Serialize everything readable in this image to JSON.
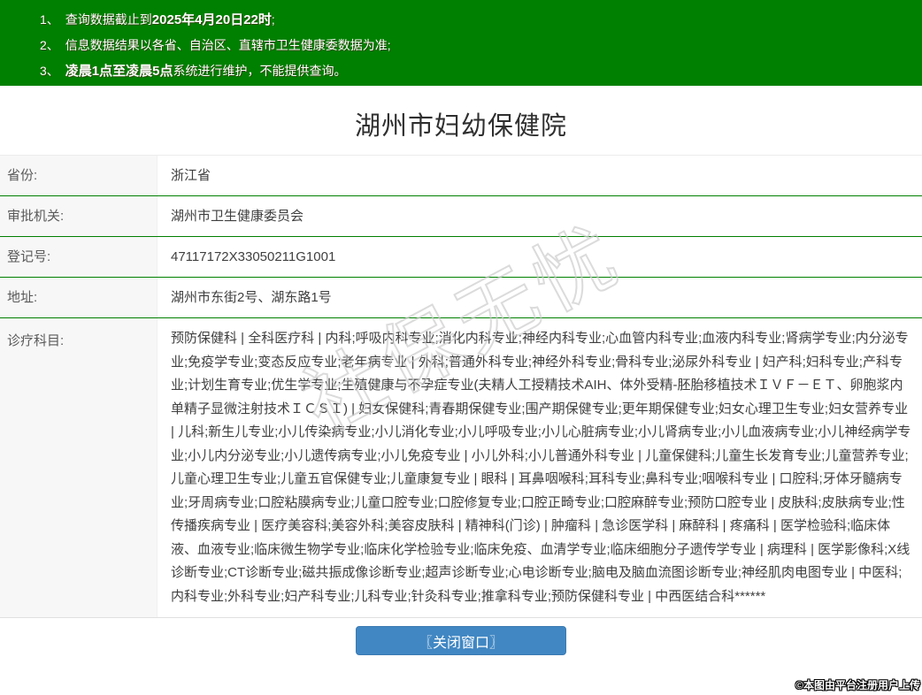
{
  "header": {
    "bg_color": "#008000",
    "text_color": "#ffffff",
    "notices": [
      {
        "num": "1、",
        "pre": "查询数据截止到",
        "bold": "2025年4月20日22时",
        "post": ";"
      },
      {
        "num": "2、",
        "pre": "信息数据结果以各省、自治区、直辖市卫生健康委数据为准;",
        "bold": "",
        "post": ""
      },
      {
        "num": "3、",
        "pre": "",
        "bold": "凌晨1点至凌晨5点",
        "post": "系统进行维护，不能提供查询。"
      }
    ]
  },
  "title": "湖州市妇幼保健院",
  "table": {
    "border_color": "#008000",
    "label_bg_color": "#f7f7f7",
    "rows": [
      {
        "label": "省份:",
        "value": "浙江省"
      },
      {
        "label": "审批机关:",
        "value": "湖州市卫生健康委员会"
      },
      {
        "label": "登记号:",
        "value": "47117172X33050211G1001"
      },
      {
        "label": "地址:",
        "value": "湖州市东街2号、湖东路1号"
      },
      {
        "label": "诊疗科目:",
        "value": "预防保健科 | 全科医疗科 | 内科;呼吸内科专业;消化内科专业;神经内科专业;心血管内科专业;血液内科专业;肾病学专业;内分泌专业;免疫学专业;变态反应专业;老年病专业 | 外科;普通外科专业;神经外科专业;骨科专业;泌尿外科专业 | 妇产科;妇科专业;产科专业;计划生育专业;优生学专业;生殖健康与不孕症专业(夫精人工授精技术AIH、体外受精-胚胎移植技术ＩＶＦ－ＥＴ、卵胞浆内单精子显微注射技术ＩＣＳＩ) | 妇女保健科;青春期保健专业;围产期保健专业;更年期保健专业;妇女心理卫生专业;妇女营养专业 | 儿科;新生儿专业;小儿传染病专业;小儿消化专业;小儿呼吸专业;小儿心脏病专业;小儿肾病专业;小儿血液病专业;小儿神经病学专业;小儿内分泌专业;小儿遗传病专业;小儿免疫专业 | 小儿外科;小儿普通外科专业 | 儿童保健科;儿童生长发育专业;儿童营养专业;儿童心理卫生专业;儿童五官保健专业;儿童康复专业 | 眼科 | 耳鼻咽喉科;耳科专业;鼻科专业;咽喉科专业 | 口腔科;牙体牙髓病专业;牙周病专业;口腔粘膜病专业;儿童口腔专业;口腔修复专业;口腔正畸专业;口腔麻醉专业;预防口腔专业 | 皮肤科;皮肤病专业;性传播疾病专业 | 医疗美容科;美容外科;美容皮肤科 | 精神科(门诊) | 肿瘤科 | 急诊医学科 | 麻醉科 | 疼痛科 | 医学检验科;临床体液、血液专业;临床微生物学专业;临床化学检验专业;临床免疫、血清学专业;临床细胞分子遗传学专业 | 病理科 | 医学影像科;X线诊断专业;CT诊断专业;磁共振成像诊断专业;超声诊断专业;心电诊断专业;脑电及脑血流图诊断专业;神经肌肉电图专业 | 中医科;内科专业;外科专业;妇产科专业;儿科专业;针灸科专业;推拿科专业;预防保健科专业 | 中西医结合科******"
      }
    ]
  },
  "watermark": "社保无忧",
  "close_button": {
    "label": "〖关闭窗口〗",
    "bg_color": "#4187c3"
  },
  "footer": {
    "credit": "©本图由平台注册用户上传"
  }
}
